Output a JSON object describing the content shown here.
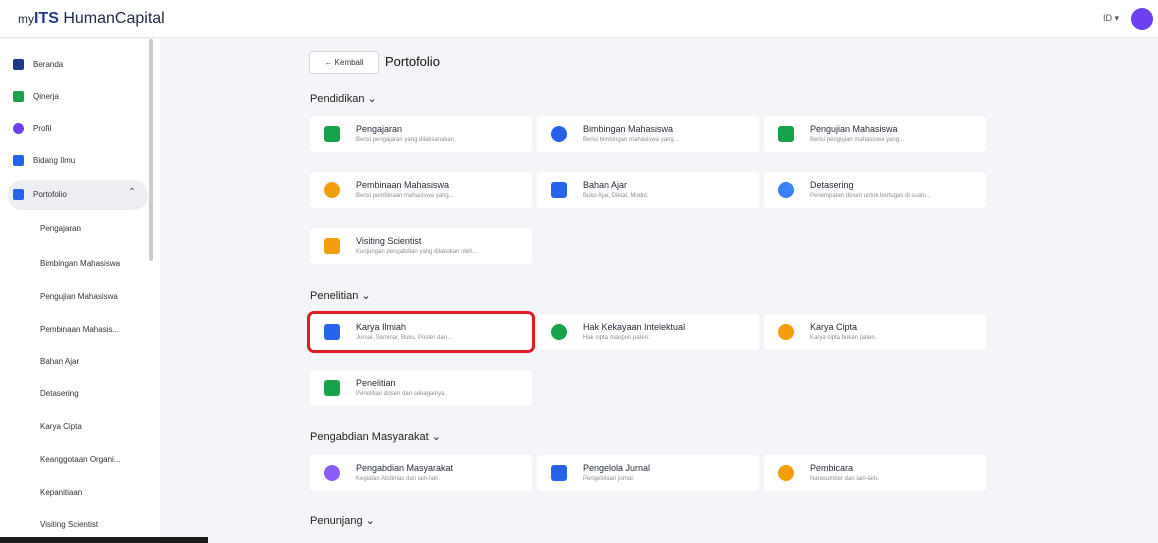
{
  "header": {
    "logo_prefix": "my",
    "logo_brand": "ITS",
    "logo_suffix": " HumanCapital",
    "language": "ID ▾"
  },
  "sidebar": {
    "items": [
      {
        "label": "Beranda",
        "icon": "home-icon",
        "color": "#1e3a8a"
      },
      {
        "label": "Qinerja",
        "icon": "qinerja-icon",
        "color": "#16a34a"
      },
      {
        "label": "Profil",
        "icon": "profile-icon",
        "color": "#6d3ff0"
      },
      {
        "label": "Bidang Ilmu",
        "icon": "book-icon",
        "color": "#2563eb"
      },
      {
        "label": "Portofolio",
        "icon": "portfolio-icon",
        "color": "#2563eb",
        "chevron": "⌃"
      }
    ],
    "subitems": [
      "Pengajaran",
      "Bimbingan Mahasiswa",
      "Pengujian Mahasiswa",
      "Pembinaan Mahasis...",
      "Bahan Ajar",
      "Detasering",
      "Karya Cipta",
      "Keanggotaan Organi...",
      "Kepanitiaan",
      "Visiting Scientist"
    ]
  },
  "main": {
    "back_label": "← Kembali",
    "title": "Portofolio",
    "sections": {
      "pendidikan": "Pendidikan ⌄",
      "penelitian": "Penelitian ⌄",
      "pengabdian": "Pengabdian Masyarakat ⌄",
      "penunjang": "Penunjang ⌄"
    },
    "cards": [
      {
        "title": "Pengajaran",
        "desc": "Berisi pengajaran yang dilaksanakan.",
        "icon": "teaching-board-icon",
        "color": "#16a34a"
      },
      {
        "title": "Bimbingan Mahasiswa",
        "desc": "Berisi bimbingan mahasiswa yang...",
        "icon": "students-icon",
        "color": "#2563eb"
      },
      {
        "title": "Pengujian Mahasiswa",
        "desc": "Berisi pengujian mahasiswa yang...",
        "icon": "exam-doc-icon",
        "color": "#16a34a"
      },
      {
        "title": "Pembinaan Mahasiswa",
        "desc": "Berisi pembinaan mahasiswa yang...",
        "icon": "mentoring-icon",
        "color": "#f59e0b"
      },
      {
        "title": "Bahan Ajar",
        "desc": "Buku Ajar, Diktat, Modul.",
        "icon": "bookmark-k-icon",
        "color": "#2563eb"
      },
      {
        "title": "Detasering",
        "desc": "Penempatan dosen untuk bertugas di suatu...",
        "icon": "handshake-icon",
        "color": "#3b82f6"
      },
      {
        "title": "Visiting Scientist",
        "desc": "Kunjungan pengabdian yang dilakukan oleh...",
        "icon": "visit-book-icon",
        "color": "#f59e0b"
      },
      {
        "title": "Karya Ilmiah",
        "desc": "Jurnal, Seminar, Buku, Poster dan...",
        "icon": "flask-icon",
        "color": "#2563eb"
      },
      {
        "title": "Hak Kekayaan Intelektual",
        "desc": "Hak cipta maupun paten.",
        "icon": "shield-lock-icon",
        "color": "#16a34a"
      },
      {
        "title": "Karya Cipta",
        "desc": "Karya cipta bukan paten.",
        "icon": "copyright-icon",
        "color": "#f59e0b"
      },
      {
        "title": "Penelitian",
        "desc": "Penelitian dosen dan sebagainya.",
        "icon": "microscope-icon",
        "color": "#16a34a"
      },
      {
        "title": "Pengabdian Masyarakat",
        "desc": "Kegiatan Abdimas dan lain-lain.",
        "icon": "heart-hands-icon",
        "color": "#8b5cf6"
      },
      {
        "title": "Pengelola Jurnal",
        "desc": "Pengelolaan jurnal.",
        "icon": "journal-icon",
        "color": "#2563eb"
      },
      {
        "title": "Pembicara",
        "desc": "Narasumber dan lain-lain.",
        "icon": "microphone-icon",
        "color": "#f59e0b"
      }
    ]
  }
}
